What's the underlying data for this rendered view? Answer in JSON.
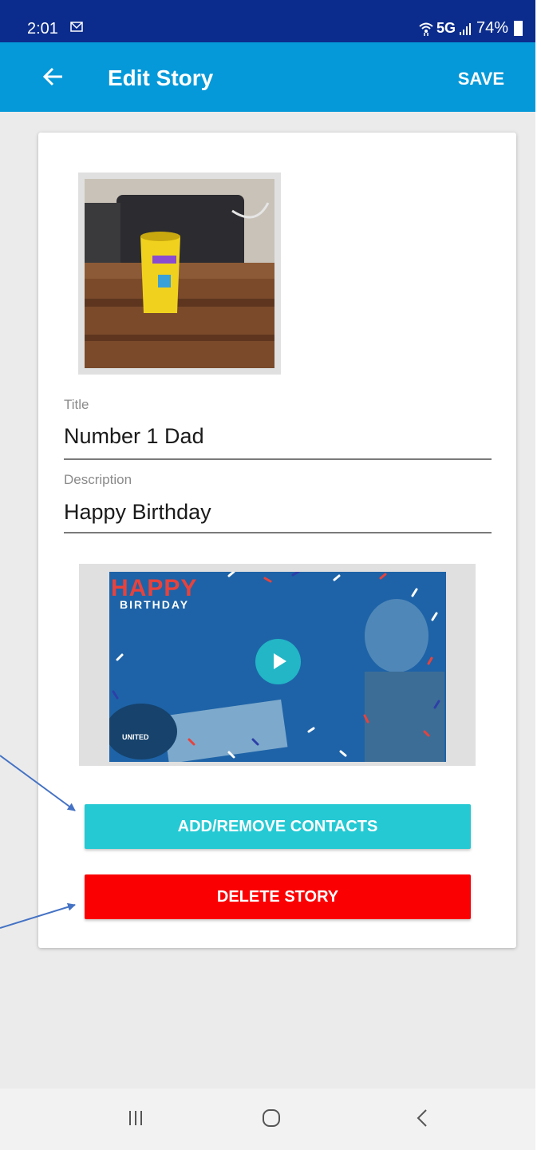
{
  "status_bar": {
    "time": "2:01",
    "network": "5G",
    "battery": "74%",
    "icons": [
      "mail-icon",
      "wifi-icon",
      "signal-icon",
      "battery-icon"
    ]
  },
  "app_bar": {
    "title": "Edit Story",
    "save_label": "SAVE",
    "back_icon": "arrow-left-icon"
  },
  "form": {
    "title_label": "Title",
    "title_value": "Number 1 Dad",
    "description_label": "Description",
    "description_value": "Happy Birthday"
  },
  "video": {
    "overlay_title": "HAPPY",
    "overlay_subtitle": "BIRTHDAY",
    "logo_text": "UNITED",
    "play_icon": "play-icon"
  },
  "buttons": {
    "contacts_label": "ADD/REMOVE CONTACTS",
    "delete_label": "DELETE STORY"
  },
  "nav": {
    "icons": [
      "recent-apps-icon",
      "home-icon",
      "back-icon"
    ]
  },
  "colors": {
    "status_bar": "#0b2c8c",
    "app_bar": "#0599d9",
    "contacts_button": "#24c9d3",
    "delete_button": "#fb0003",
    "annotation_arrow": "#4472c4"
  }
}
